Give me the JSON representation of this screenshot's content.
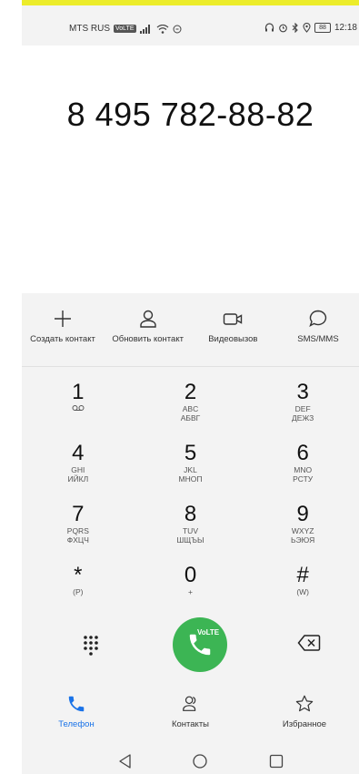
{
  "status_bar": {
    "carrier": "MTS RUS",
    "volte": "VoLTE",
    "battery": "88",
    "time": "12:18"
  },
  "display": {
    "number": "8 495 782-88-82"
  },
  "actions": [
    {
      "label": "Создать контакт",
      "icon": "plus-icon"
    },
    {
      "label": "Обновить контакт",
      "icon": "person-icon"
    },
    {
      "label": "Видеовызов",
      "icon": "video-camera-icon"
    },
    {
      "label": "SMS/MMS",
      "icon": "chat-bubble-icon"
    }
  ],
  "keypad": [
    {
      "digit": "1",
      "sub1": "",
      "sub2": ""
    },
    {
      "digit": "2",
      "sub1": "ABC",
      "sub2": "АБВГ"
    },
    {
      "digit": "3",
      "sub1": "DEF",
      "sub2": "ДЕЖЗ"
    },
    {
      "digit": "4",
      "sub1": "GHI",
      "sub2": "ИЙКЛ"
    },
    {
      "digit": "5",
      "sub1": "JKL",
      "sub2": "МНОП"
    },
    {
      "digit": "6",
      "sub1": "MNO",
      "sub2": "РСТУ"
    },
    {
      "digit": "7",
      "sub1": "PQRS",
      "sub2": "ФХЦЧ"
    },
    {
      "digit": "8",
      "sub1": "TUV",
      "sub2": "ШЩЪЫ"
    },
    {
      "digit": "9",
      "sub1": "WXYZ",
      "sub2": "ЬЭЮЯ"
    },
    {
      "digit": "*",
      "sub1": "(P)",
      "sub2": ""
    },
    {
      "digit": "0",
      "sub1": "+",
      "sub2": ""
    },
    {
      "digit": "#",
      "sub1": "(W)",
      "sub2": ""
    }
  ],
  "call": {
    "volte_label": "VoLTE"
  },
  "bottom_nav": [
    {
      "label": "Телефон",
      "icon": "phone-icon",
      "active": true
    },
    {
      "label": "Контакты",
      "icon": "contacts-icon",
      "active": false
    },
    {
      "label": "Избранное",
      "icon": "star-icon",
      "active": false
    }
  ],
  "colors": {
    "accent": "#1a73e8",
    "call_green": "#3cb554",
    "top_bar": "#ecec2a"
  }
}
